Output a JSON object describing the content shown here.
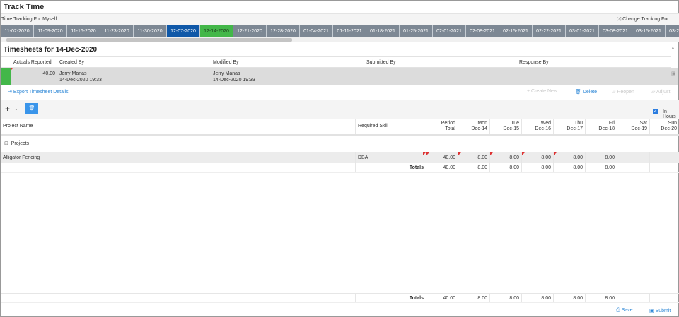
{
  "header": {
    "title": "Track Time",
    "subtitle": "Time Tracking For Myself",
    "change_tracking": "Change Tracking For...",
    "change_icon": "shuffle-icon"
  },
  "weeks": [
    "11-02-2020",
    "11-09-2020",
    "11-16-2020",
    "11-23-2020",
    "11-30-2020",
    "12-07-2020",
    "12-14-2020",
    "12-21-2020",
    "12-28-2020",
    "01-04-2021",
    "01-11-2021",
    "01-18-2021",
    "01-25-2021",
    "02-01-2021",
    "02-08-2021",
    "02-15-2021",
    "02-22-2021",
    "03-01-2021",
    "03-08-2021",
    "03-15-2021",
    "03-22-2021"
  ],
  "selected_week": "12-07-2020",
  "current_week": "12-14-2020",
  "timesheets": {
    "title": "Timesheets for 14-Dec-2020",
    "columns": [
      "Actuals Reported",
      "Created By",
      "Modified By",
      "Submitted By",
      "Response By"
    ],
    "row": {
      "actuals": "40.00",
      "created_by": "Jerry Manas",
      "created_at": "14-Dec-2020 19:33",
      "modified_by": "Jerry Manas",
      "modified_at": "14-Dec-2020 19:33"
    }
  },
  "actions": {
    "export": "Export Timesheet Details",
    "create_new": "Create New",
    "delete": "Delete",
    "reopen": "Reopen",
    "adjust": "Adjust"
  },
  "toolbar": {
    "in_hours": "In Hours",
    "in_hours_checked": true
  },
  "table": {
    "columns": [
      {
        "l1": "Project Name"
      },
      {
        "l1": "Required Skill"
      },
      {
        "l1": "Period",
        "l2": "Total"
      },
      {
        "l1": "Mon",
        "l2": "Dec-14"
      },
      {
        "l1": "Tue",
        "l2": "Dec-15"
      },
      {
        "l1": "Wed",
        "l2": "Dec-16"
      },
      {
        "l1": "Thu",
        "l2": "Dec-17"
      },
      {
        "l1": "Fri",
        "l2": "Dec-18"
      },
      {
        "l1": "Sat",
        "l2": "Dec-19"
      },
      {
        "l1": "Sun",
        "l2": "Dec-20"
      }
    ],
    "group": "Projects",
    "row": {
      "project": "Alligator Fencing",
      "skill": "DBA",
      "values": [
        "40.00",
        "8.00",
        "8.00",
        "8.00",
        "8.00",
        "8.00",
        "",
        ""
      ]
    },
    "totals_label": "Totals",
    "totals": [
      "40.00",
      "8.00",
      "8.00",
      "8.00",
      "8.00",
      "8.00",
      "",
      ""
    ]
  },
  "footer": {
    "save": "Save",
    "submit": "Submit"
  },
  "colors": {
    "selected": "#0f58a8",
    "current": "#43b749",
    "accent": "#2b86d6"
  }
}
